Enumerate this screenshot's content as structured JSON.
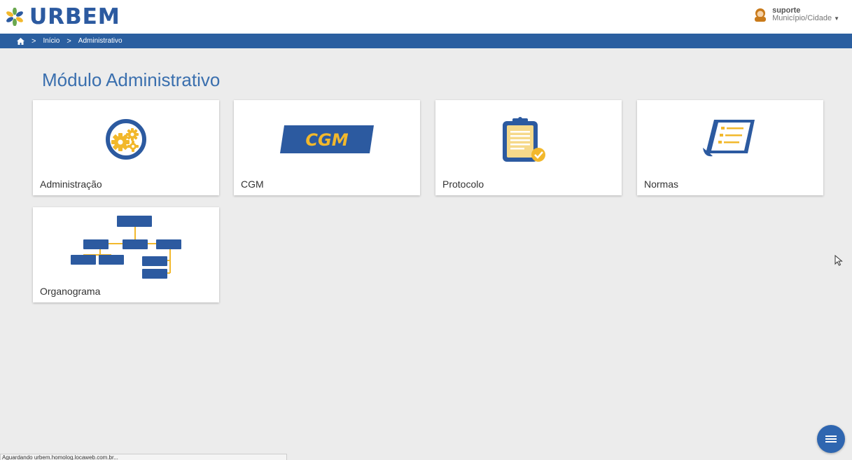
{
  "header": {
    "logo_text": "URBEM",
    "user": {
      "name": "suporte",
      "context": "Município/Cidade"
    }
  },
  "breadcrumb": {
    "items": [
      "Início",
      "Administrativo"
    ]
  },
  "page": {
    "title": "Módulo Administrativo"
  },
  "modules": [
    {
      "label": "Administração",
      "icon": "gears-icon"
    },
    {
      "label": "CGM",
      "icon": "cgm-icon",
      "badge": "CGM"
    },
    {
      "label": "Protocolo",
      "icon": "clipboard-icon"
    },
    {
      "label": "Normas",
      "icon": "document-icon"
    },
    {
      "label": "Organograma",
      "icon": "org-chart-icon"
    }
  ],
  "status_bar": {
    "text": "Aguardando urbem.homolog.locaweb.com.br..."
  },
  "colors": {
    "primary": "#2b5fa0",
    "accent": "#f2b82c"
  }
}
